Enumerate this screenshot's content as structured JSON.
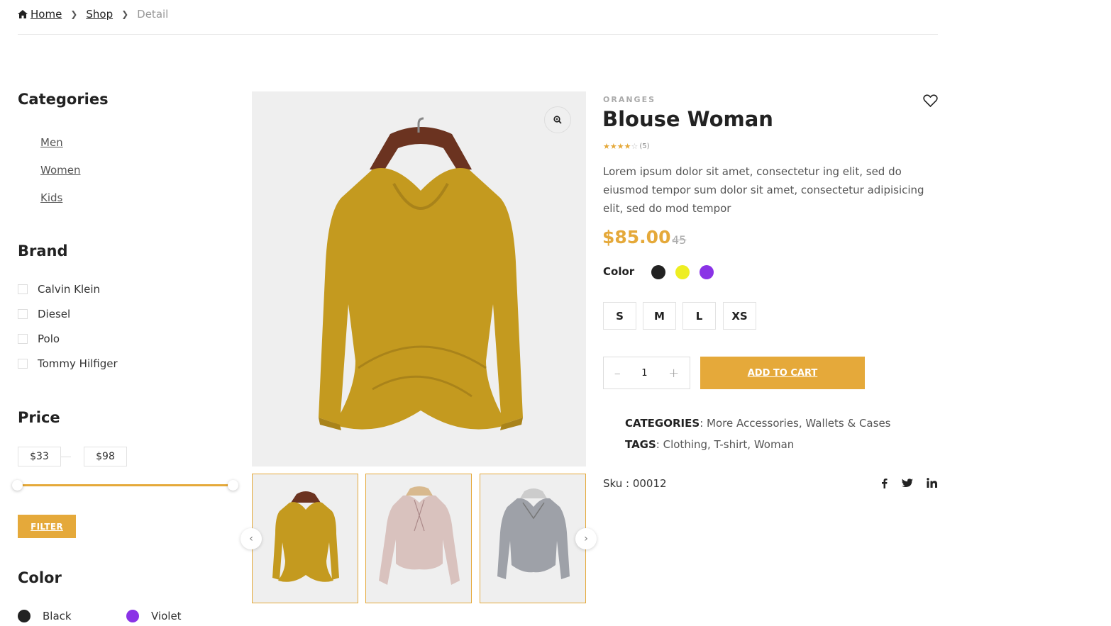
{
  "breadcrumb": {
    "home": "Home",
    "shop": "Shop",
    "current": "Detail"
  },
  "sidebar": {
    "categories_title": "Categories",
    "categories": [
      "Men",
      "Women",
      "Kids"
    ],
    "brand_title": "Brand",
    "brands": [
      "Calvin Klein",
      "Diesel",
      "Polo",
      "Tommy Hilfiger"
    ],
    "price_title": "Price",
    "price_min": "$33",
    "price_max": "$98",
    "filter_label": "FILTER",
    "color_title": "Color",
    "colors": [
      {
        "name": "Black",
        "hex": "#222222"
      },
      {
        "name": "Violet",
        "hex": "#8a33e6"
      }
    ]
  },
  "product": {
    "brand": "ORANGES",
    "title": "Blouse Woman",
    "rating": 4,
    "rating_count": "(5)",
    "description": "Lorem ipsum dolor sit amet, consectetur ing elit, sed do eiusmod tempor sum dolor sit amet, consectetur adipisicing elit, sed do mod tempor",
    "price": "$85.00",
    "old_price": "45",
    "color_label": "Color",
    "swatches": [
      "#222222",
      "#eeee22",
      "#8a33e6"
    ],
    "sizes": [
      "S",
      "M",
      "L",
      "XS"
    ],
    "quantity": "1",
    "qty_minus": "–",
    "qty_plus": "+",
    "add_to_cart": "ADD TO CART",
    "categories_label": "CATEGORIES",
    "categories_value": ": More Accessories, Wallets & Cases",
    "tags_label": "TAGS",
    "tags_value": ": Clothing, T-shirt, Woman",
    "sku": "Sku : 00012"
  },
  "colors": {
    "accent": "#e5a93a",
    "mustard": "#c49a1f",
    "pink": "#d9c2be",
    "grey": "#9ea1a8"
  },
  "icons": [
    "home-icon",
    "chevron-right-icon",
    "zoom-icon",
    "heart-icon",
    "chevron-left-icon",
    "facebook-icon",
    "twitter-icon",
    "linkedin-icon"
  ]
}
